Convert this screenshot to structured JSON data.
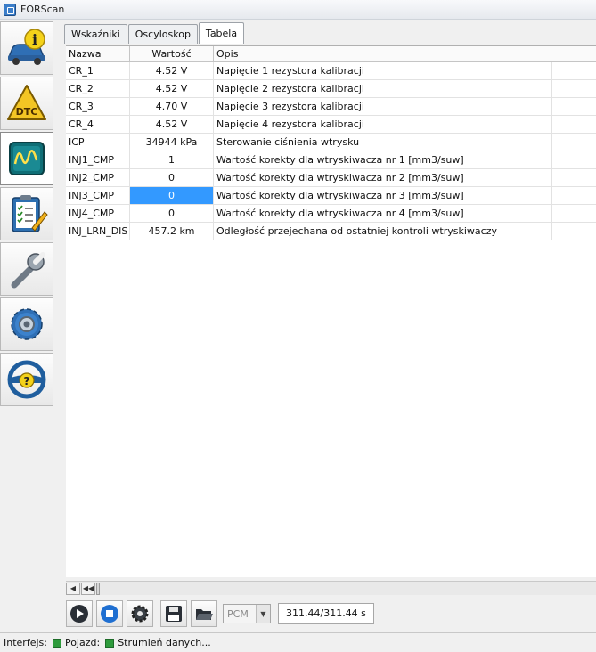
{
  "window": {
    "title": "FORScan"
  },
  "sidebar": {
    "items": [
      {
        "name": "vehicle-info",
        "icon": "car-info-icon"
      },
      {
        "name": "dtc",
        "icon": "dtc-warning-icon"
      },
      {
        "name": "oscilloscope",
        "icon": "oscilloscope-icon"
      },
      {
        "name": "tests",
        "icon": "clipboard-check-icon"
      },
      {
        "name": "service",
        "icon": "wrench-icon"
      },
      {
        "name": "configuration",
        "icon": "gear-icon"
      },
      {
        "name": "help",
        "icon": "steering-help-icon"
      }
    ],
    "active_index": 2
  },
  "tabs": [
    {
      "label": "Wskaźniki"
    },
    {
      "label": "Oscyloskop"
    },
    {
      "label": "Tabela"
    }
  ],
  "grid": {
    "columns": {
      "name": "Nazwa",
      "value": "Wartość",
      "desc": "Opis"
    },
    "rows": [
      {
        "name": "CR_1",
        "value": "4.52 V",
        "desc": "Napięcie 1 rezystora kalibracji"
      },
      {
        "name": "CR_2",
        "value": "4.52 V",
        "desc": "Napięcie 2 rezystora kalibracji"
      },
      {
        "name": "CR_3",
        "value": "4.70 V",
        "desc": "Napięcie 3 rezystora kalibracji"
      },
      {
        "name": "CR_4",
        "value": "4.52 V",
        "desc": "Napięcie 4 rezystora kalibracji"
      },
      {
        "name": "ICP",
        "value": "34944 kPa",
        "desc": "Sterowanie ciśnienia wtrysku"
      },
      {
        "name": "INJ1_CMP",
        "value": "1",
        "desc": "Wartość korekty dla wtryskiwacza nr 1 [mm3/suw]"
      },
      {
        "name": "INJ2_CMP",
        "value": "0",
        "desc": "Wartość korekty dla wtryskiwacza nr 2 [mm3/suw]"
      },
      {
        "name": "INJ3_CMP",
        "value": "0",
        "desc": "Wartość korekty dla wtryskiwacza nr 3 [mm3/suw]"
      },
      {
        "name": "INJ4_CMP",
        "value": "0",
        "desc": "Wartość korekty dla wtryskiwacza nr 4 [mm3/suw]"
      },
      {
        "name": "INJ_LRN_DIS",
        "value": "457.2 km",
        "desc": "Odległość przejechana od ostatniej kontroli wtryskiwaczy"
      }
    ],
    "selected_row": 7
  },
  "controls": {
    "ecu": "PCM",
    "time": "311.44/311.44 s"
  },
  "status": {
    "interface_label": "Interfejs:",
    "vehicle_label": "Pojazd:",
    "stream_label": "Strumień danych...",
    "led_color": "#2e9b3c"
  }
}
